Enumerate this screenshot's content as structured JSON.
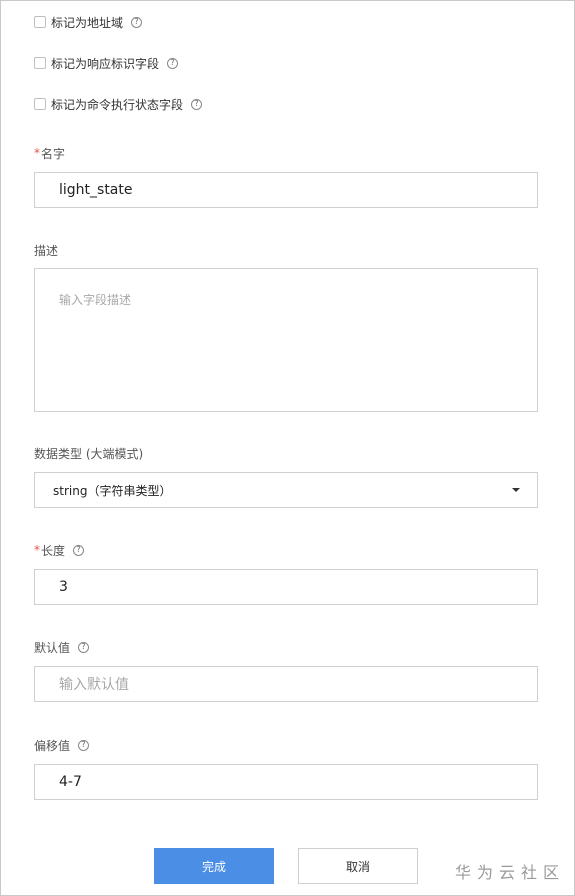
{
  "checkboxes": [
    {
      "label": "标记为地址域",
      "checked": false
    },
    {
      "label": "标记为响应标识字段",
      "checked": false
    },
    {
      "label": "标记为命令执行状态字段",
      "checked": false
    }
  ],
  "help_glyph": "?",
  "name_field": {
    "required_mark": "*",
    "label": "名字",
    "value": "light_state"
  },
  "description_field": {
    "label": "描述",
    "placeholder": "输入字段描述"
  },
  "data_type_field": {
    "label": "数据类型 (大端模式)",
    "selected": "string（字符串类型）"
  },
  "length_field": {
    "required_mark": "*",
    "label": "长度",
    "value": "3"
  },
  "default_field": {
    "label": "默认值",
    "placeholder": "输入默认值"
  },
  "offset_field": {
    "label": "偏移值",
    "value": "4-7"
  },
  "buttons": {
    "confirm": "完成",
    "cancel": "取消"
  },
  "watermark": "华为云社区",
  "colors": {
    "primary": "#4a8ee6",
    "required": "#e5534b",
    "border": "#d0d0d0"
  }
}
